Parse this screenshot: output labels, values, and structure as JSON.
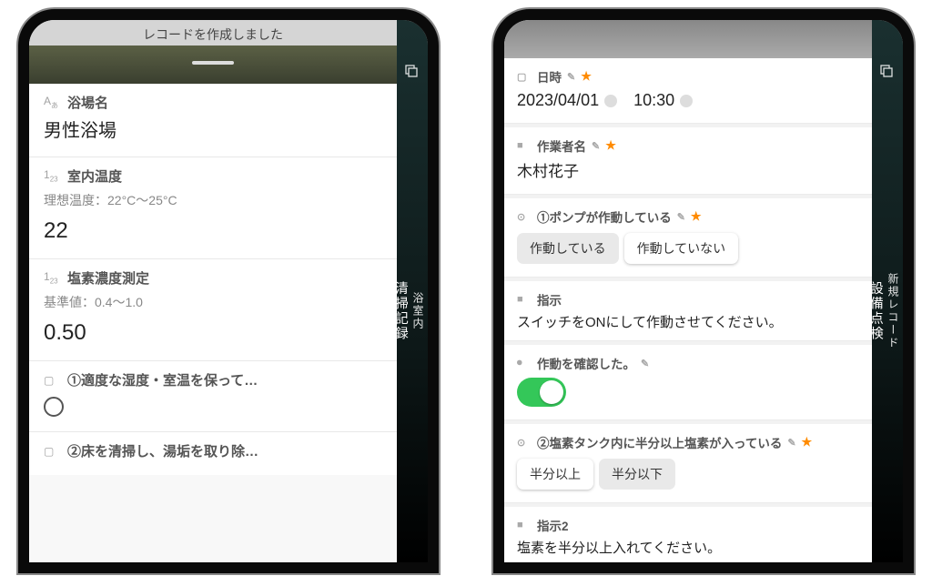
{
  "left": {
    "toast": "レコードを作成しました",
    "side_main": "清掃記録",
    "side_sub": "浴室内",
    "bath_name": {
      "label": "浴場名",
      "value": "男性浴場"
    },
    "room_temp": {
      "label": "室内温度",
      "ideal": "理想温度：22°C～25°C",
      "value": "22"
    },
    "chlorine": {
      "label": "塩素濃度測定",
      "standard": "基準値：0.4～1.0",
      "value": "0.50"
    },
    "check1_label": "①適度な湿度・室温を保って…",
    "check2_label": "②床を清掃し、湯垢を取り除…"
  },
  "right": {
    "side_main": "設備点検",
    "side_sub": "新規レコード",
    "datetime": {
      "label": "日時",
      "date": "2023/04/01",
      "time": "10:30"
    },
    "worker": {
      "label": "作業者名",
      "value": "木村花子"
    },
    "q1": {
      "label": "①ポンプが作動している",
      "opt1": "作動している",
      "opt2": "作動していない"
    },
    "instruction": {
      "label": "指示",
      "text": "スイッチをONにして作動させてください。"
    },
    "confirm": {
      "label": "作動を確認した。"
    },
    "q2": {
      "label": "②塩素タンク内に半分以上塩素が入っている",
      "opt1": "半分以上",
      "opt2": "半分以下"
    },
    "instruction2": {
      "label": "指示2",
      "text": "塩素を半分以上入れてください。"
    }
  }
}
